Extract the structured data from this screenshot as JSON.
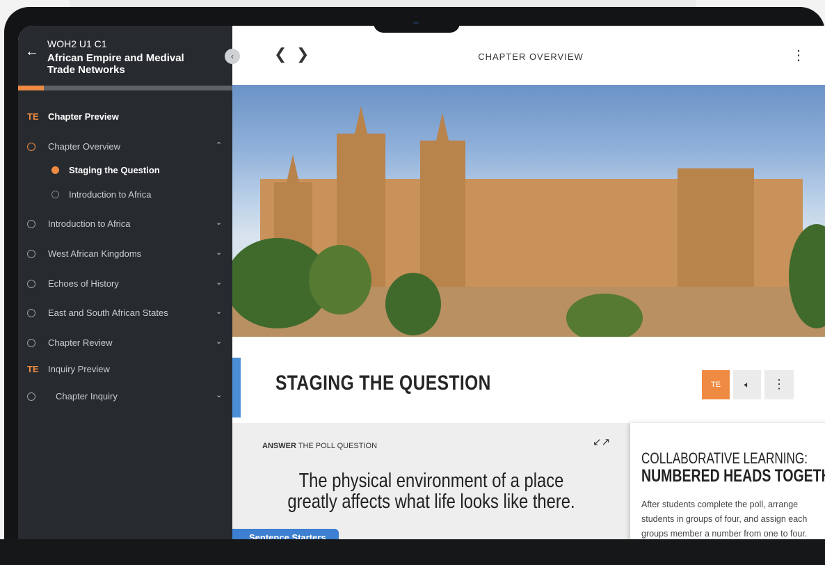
{
  "course": {
    "code": "WOH2 U1 C1",
    "title": "African Empire and Medival Trade Networks",
    "progress_fraction": 0.12
  },
  "sidebar": {
    "items": [
      {
        "tag": "TE",
        "label": "Chapter Preview",
        "bold": true
      },
      {
        "label": "Chapter Overview",
        "chevron": "up"
      },
      {
        "label": "Staging the Question",
        "sub": true,
        "active": true
      },
      {
        "label": "Introduction to Africa",
        "sub": true
      },
      {
        "label": "Introduction to Africa",
        "chevron": "down"
      },
      {
        "label": "West African Kingdoms",
        "chevron": "down"
      },
      {
        "label": "Echoes of History",
        "chevron": "down"
      },
      {
        "label": "East and South African States",
        "chevron": "down"
      },
      {
        "label": "Chapter Review",
        "chevron": "down"
      },
      {
        "tag": "TE",
        "label": "Inquiry Preview"
      },
      {
        "label": "Chapter Inquiry",
        "chevron": "down"
      }
    ]
  },
  "header": {
    "title": "CHAPTER OVERVIEW"
  },
  "section": {
    "title": "STAGING THE QUESTION",
    "te_label": "TE"
  },
  "poll": {
    "kicker_bold": "ANSWER",
    "kicker_rest": "THE POLL QUESTION",
    "question": "The physical environment of a place greatly affects what life looks like there.",
    "starters_label": "Sentence Starters"
  },
  "collab": {
    "title_line1": "COLLABORATIVE LEARNING:",
    "title_line2": "NUMBERED HEADS TOGETHER",
    "body": "After students complete the poll, arrange students in groups of four, and assign each groups member a number from one to four."
  },
  "colors": {
    "accent": "#ef8a43",
    "sidebar_bg": "#272b2f",
    "link_blue": "#3d7fd0"
  }
}
